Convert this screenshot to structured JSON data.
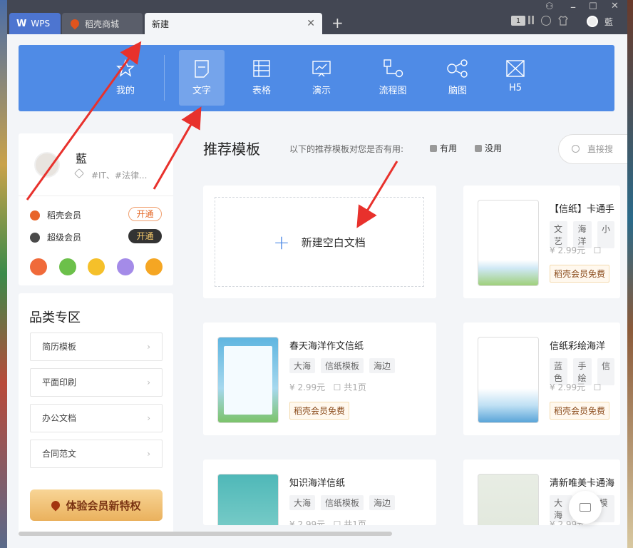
{
  "titlebar": {
    "tabs": [
      {
        "label": "WPS",
        "logo": "W"
      },
      {
        "label": "稻壳商城"
      },
      {
        "label": "新建"
      }
    ],
    "badge": "1",
    "user": "藍"
  },
  "nav": {
    "items": [
      {
        "label": "我的",
        "icon": "star-icon"
      },
      {
        "label": "文字",
        "icon": "document-icon",
        "active": true
      },
      {
        "label": "表格",
        "icon": "table-icon"
      },
      {
        "label": "演示",
        "icon": "presentation-icon"
      },
      {
        "label": "流程图",
        "icon": "flowchart-icon"
      },
      {
        "label": "脑图",
        "icon": "mindmap-icon"
      },
      {
        "label": "H5",
        "icon": "h5-icon"
      }
    ],
    "color": "#4f8be6"
  },
  "profile": {
    "name": "藍",
    "tags": "#IT、#法律...",
    "memberships": [
      {
        "label": "稻壳会员",
        "button": "开通"
      },
      {
        "label": "超级会员",
        "button": "开通"
      }
    ]
  },
  "categories": {
    "title": "品类专区",
    "items": [
      "简历模板",
      "平面印刷",
      "办公文档",
      "合同范文"
    ],
    "trial_button": "体验会员新特权"
  },
  "main": {
    "title": "推荐模板",
    "useful_question": "以下的推荐模板对您是否有用:",
    "useful_yes": "有用",
    "useful_no": "没用",
    "search_placeholder": "直接搜",
    "blank_doc": "新建空白文档"
  },
  "templates": [
    {
      "name": "【信纸】卡通手",
      "tags": [
        "文艺",
        "海洋",
        "小"
      ],
      "price": "2.99元",
      "pages": "",
      "free": "稻壳会员免费"
    },
    {
      "name": "春天海洋作文信纸",
      "tags": [
        "大海",
        "信纸模板",
        "海边"
      ],
      "price": "2.99元",
      "pages": "共1页",
      "free": "稻壳会员免费"
    },
    {
      "name": "信纸彩绘海洋",
      "tags": [
        "蓝色",
        "手绘",
        "信"
      ],
      "price": "2.99元",
      "pages": "",
      "free": "稻壳会员免费"
    },
    {
      "name": "知识海洋信纸",
      "tags": [
        "大海",
        "信纸模板",
        "海边"
      ],
      "price": "2.99元",
      "pages": "共1页",
      "free": ""
    },
    {
      "name": "清新唯美卡通海",
      "tags": [
        "大海",
        "信纸模板"
      ],
      "price": "2.99元",
      "pages": "",
      "free": ""
    }
  ]
}
